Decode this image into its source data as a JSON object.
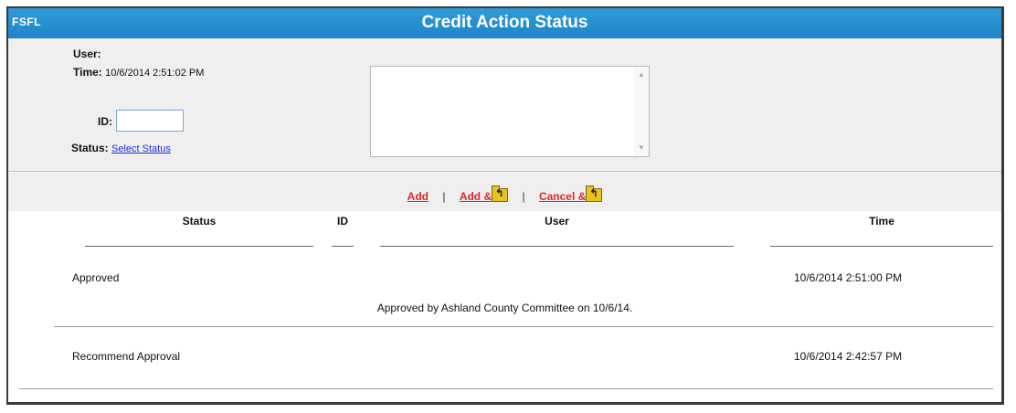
{
  "window": {
    "abbr": "FSFL",
    "title": "Credit Action Status"
  },
  "form": {
    "user_label": "User:",
    "user_value": "",
    "time_label": "Time:",
    "time_value": "10/6/2014 2:51:02 PM",
    "id_label": "ID:",
    "id_value": "",
    "status_label": "Status:",
    "status_link": "Select Status",
    "comment_value": ""
  },
  "actions": {
    "add": "Add",
    "add_and": "Add &",
    "cancel_and": "Cancel &",
    "separator": "|"
  },
  "table": {
    "columns": [
      "Status",
      "ID",
      "User",
      "Time"
    ],
    "rows": [
      {
        "status": "Approved",
        "id": "",
        "user": "",
        "time": "10/6/2014 2:51:00 PM",
        "comment": "Approved by Ashland County Committee on 10/6/14."
      },
      {
        "status": "Recommend Approval",
        "id": "",
        "user": "",
        "time": "10/6/2014 2:42:57 PM",
        "comment": ""
      }
    ]
  },
  "colors": {
    "title_bar": "#1f86c8",
    "panel_bg": "#efefef",
    "action_link": "#e0262b",
    "status_link": "#1a2fd6"
  },
  "icons": [
    "folder-return-icon"
  ]
}
